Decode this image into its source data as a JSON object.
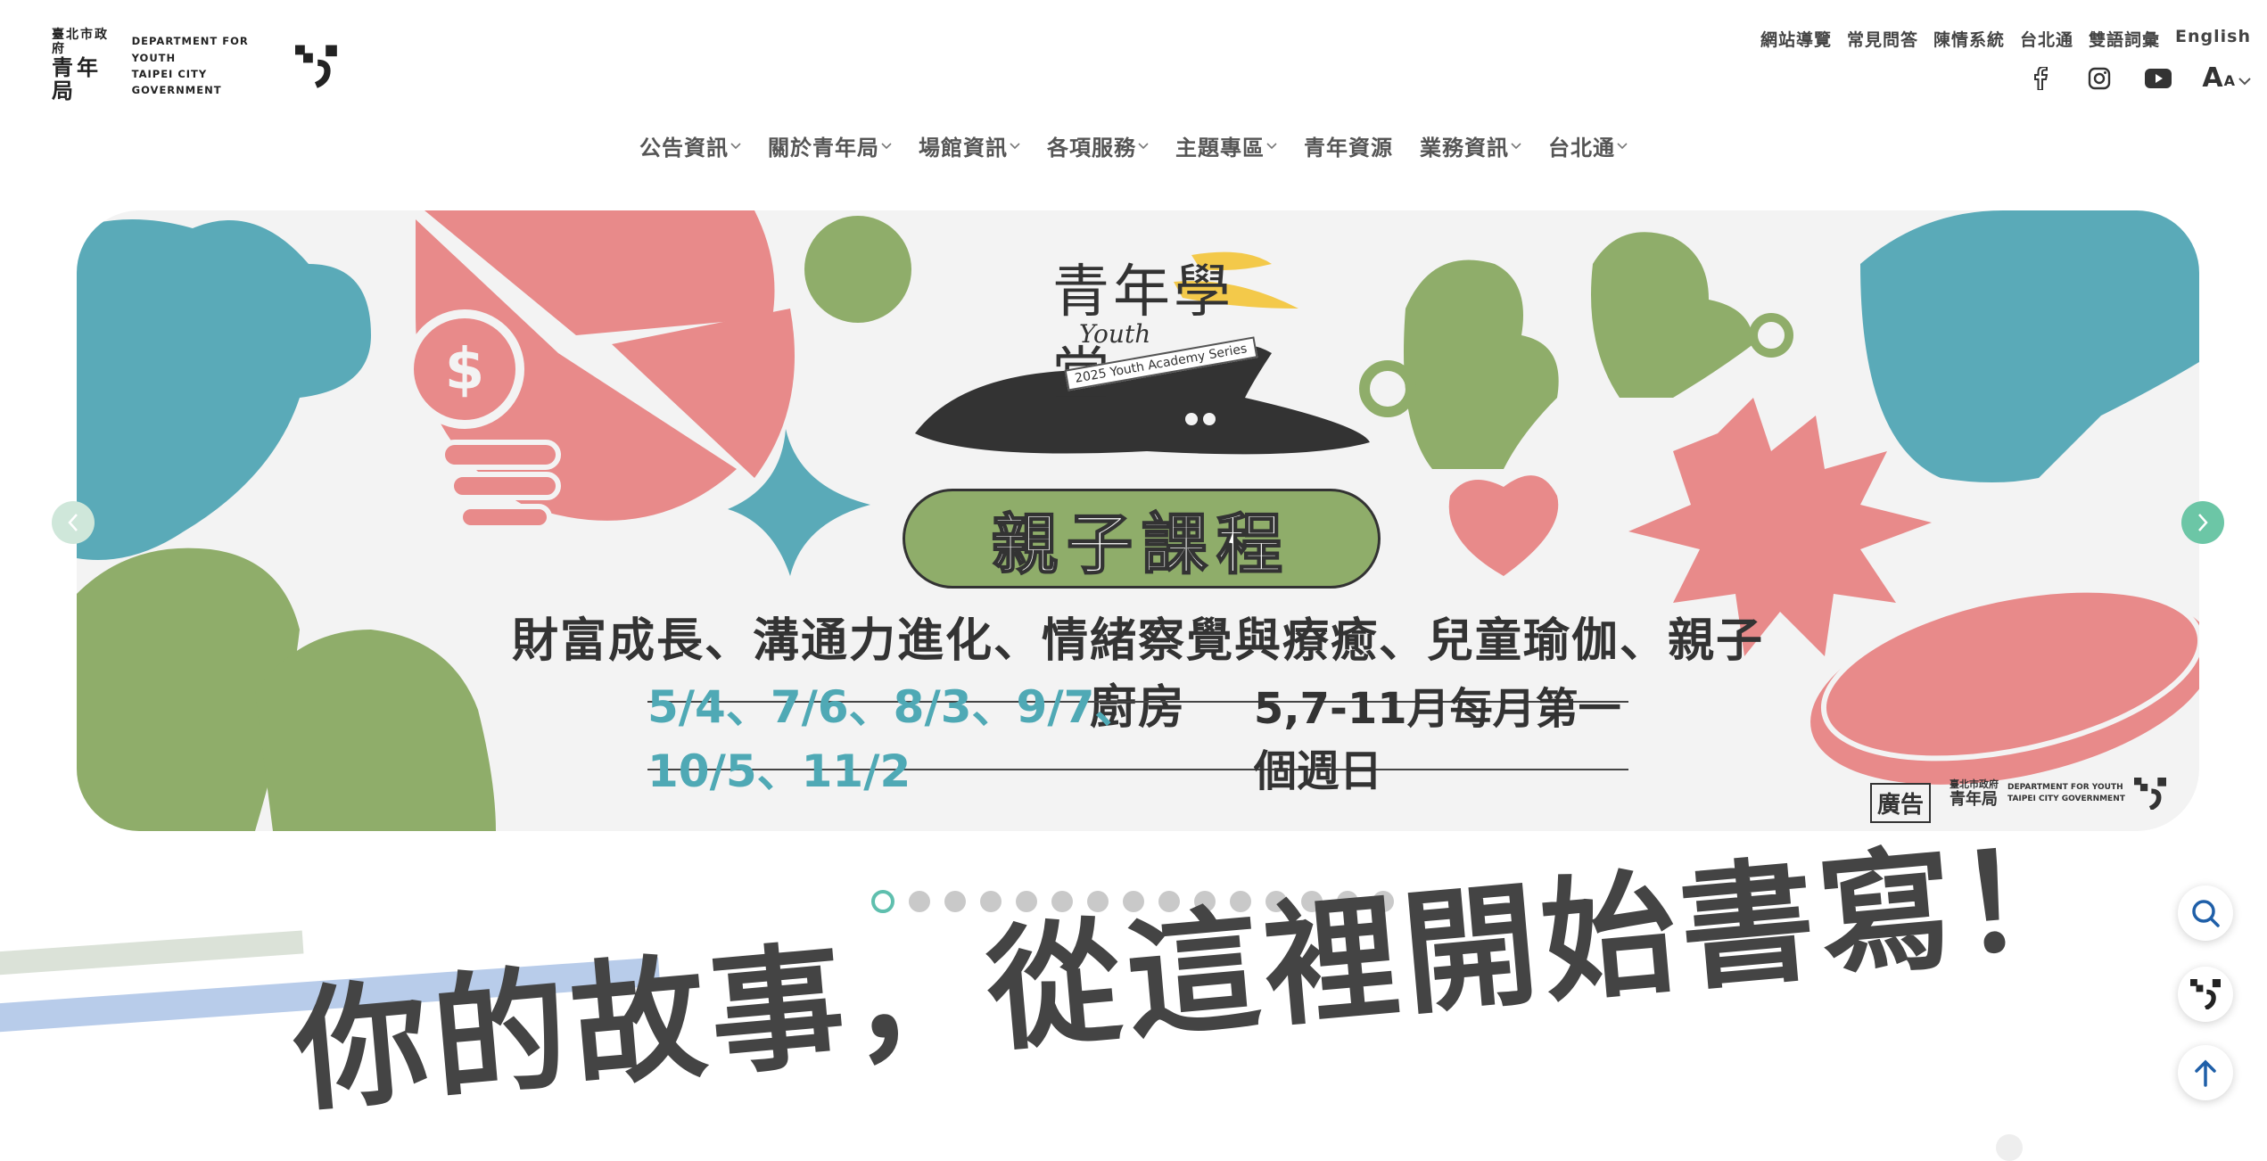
{
  "logo": {
    "zh_line1": "臺北市政府",
    "zh_line2": "青年局",
    "en_line1": "DEPARTMENT  FOR  YOUTH",
    "en_line2": "TAIPEI  CITY  GOVERNMENT"
  },
  "util_nav": [
    "網站導覽",
    "常見問答",
    "陳情系統",
    "台北通",
    "雙語詞彙",
    "English"
  ],
  "social": {
    "facebook_icon": "facebook-icon",
    "instagram_icon": "instagram-icon",
    "youtube_icon": "youtube-icon",
    "font_size_label": "A",
    "font_size_small": "A"
  },
  "main_nav": [
    {
      "label": "公告資訊",
      "has_dropdown": true
    },
    {
      "label": "關於青年局",
      "has_dropdown": true
    },
    {
      "label": "場館資訊",
      "has_dropdown": true
    },
    {
      "label": "各項服務",
      "has_dropdown": true
    },
    {
      "label": "主題專區",
      "has_dropdown": true
    },
    {
      "label": "青年資源",
      "has_dropdown": false
    },
    {
      "label": "業務資訊",
      "has_dropdown": true
    },
    {
      "label": "台北通",
      "has_dropdown": true
    }
  ],
  "banner": {
    "title_zh": "青年學堂",
    "title_en": "Youth",
    "series_tag": "2025 Youth Academy Series",
    "pill": "親子課程",
    "subtitle": "財富成長、溝通力進化、情緒察覺與療癒、兒童瑜伽、親子廚房",
    "dates_blue": "5/4、7/6、8/3、9/7、10/5、11/2",
    "dates_black": "5,7-11月每月第一個週日",
    "ad_badge": "廣告",
    "ad_logo_zh1": "臺北市政府",
    "ad_logo_zh2": "青年局",
    "ad_logo_en1": "DEPARTMENT FOR YOUTH",
    "ad_logo_en2": "TAIPEI CITY GOVERNMENT"
  },
  "carousel": {
    "total_slides": 15,
    "active_index": 0
  },
  "headline": "你的故事，從這裡開始書寫！",
  "colors": {
    "teal": "#5aaab8",
    "pink": "#e88a8a",
    "green": "#8fad6a",
    "dark": "#333333",
    "accent": "#5fbfae"
  }
}
